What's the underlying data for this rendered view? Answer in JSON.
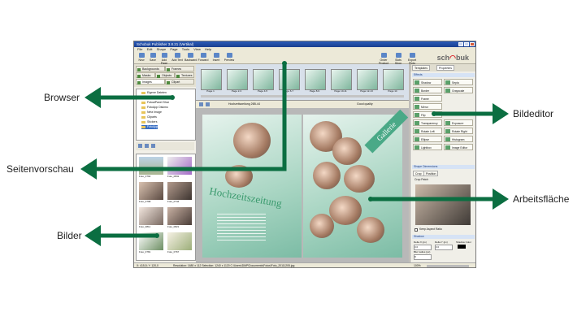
{
  "window": {
    "title": "Schobuk Publisher 3.8.21 (Vertikal)"
  },
  "menu": [
    "File",
    "Edit",
    "Shape",
    "Page",
    "Tools",
    "View",
    "Help"
  ],
  "toolbar": {
    "left": [
      "New",
      "Save",
      "Add Page",
      "Add Text",
      "Backward",
      "Forward",
      "Insert",
      "Preview"
    ],
    "right": [
      "Order Product",
      "Slots Shop",
      "Export Pictu"
    ],
    "logo_pre": "sch",
    "logo_mid": "◠",
    "logo_post": "buk"
  },
  "left_tabs": [
    "Backgrounds",
    "Frames",
    "Masks",
    "Objects",
    "Textures",
    "Images",
    "Clipart"
  ],
  "tree": [
    "Eigene Dateien",
    "Polar",
    "FotoalPanel Shar",
    "FotoApp Diskmo",
    "Netz Image",
    "Cliparts",
    "Stickers",
    "FotoApp"
  ],
  "thumbs": [
    "Foto_0794",
    "Foto_0832",
    "Foto_0798",
    "Foto_0744",
    "Foto_0811",
    "Foto_0821",
    "Foto_0781",
    "Foto_0767"
  ],
  "pages": [
    "Page 1",
    "Page 2-3",
    "Page 4-5",
    "Page 6-7",
    "Page 8-9",
    "Page 10-11",
    "Page 12-13",
    "Page 14"
  ],
  "subbar": {
    "doc": "Hochzeitszeitung 26B-44",
    "quality": "Good quality"
  },
  "canvas": {
    "title_left": "Hochzeitszeitung",
    "title_right": "Gallerie"
  },
  "right_tabs": [
    "Templates",
    "Properties"
  ],
  "effects": {
    "header": "Effects",
    "buttons": [
      "Shadow",
      "Sepia",
      "Border",
      "Grayscale",
      "Frame",
      "",
      "Mirror",
      "",
      "Flip",
      "",
      "Transparency",
      "Exposure",
      "Rotate Left",
      "Rotate Right",
      "Ellipse",
      "Histogram",
      "Lightbox",
      "Image Editor"
    ]
  },
  "shape_header": "Shape Dimensions",
  "crop_tabs": [
    "Crop",
    "Position"
  ],
  "crop_label": "Crop Patch",
  "keep_aspect": "Keep Aspect Ratio",
  "shadow_header": "Shadow",
  "shadow_labels": [
    "Delta X (px)",
    "Delta Y (px)",
    "Shadow Color",
    "Blur radius (px)"
  ],
  "shadow_values": [
    "3.0",
    "3.0",
    "8"
  ],
  "status": {
    "coords": "X: 415,5; Y: 120,0",
    "info": "Resolution: 1680 x 112   Selection: 1240 x 1120   C:\\Users\\DMP\\Documents\\Fotos\\Foto_20111205.jpg",
    "zoom": "100%"
  },
  "callouts": {
    "browser": "Browser",
    "preview": "Seitenvorschau",
    "images": "Bilder",
    "editor": "Bildeditor",
    "workspace": "Arbeitsfläche"
  },
  "colors": {
    "arrow": "#0b6e41",
    "accent": "#2a5bb8"
  }
}
